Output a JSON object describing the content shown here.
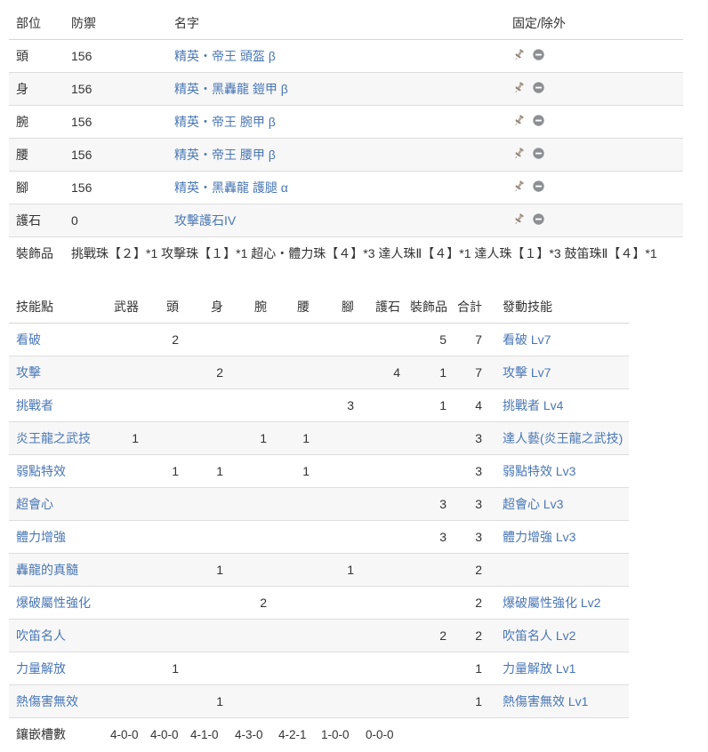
{
  "equipment_table": {
    "columns": [
      "部位",
      "防禦",
      "名字",
      "固定/除外"
    ],
    "rows": [
      {
        "part": "頭",
        "defense": "156",
        "name": "精英・帝王 頭盔 β",
        "pin_icon": "pushpin-icon",
        "exclude_icon": "minus-circle-icon"
      },
      {
        "part": "身",
        "defense": "156",
        "name": "精英・黑轟龍 鎧甲 β",
        "pin_icon": "pushpin-icon",
        "exclude_icon": "minus-circle-icon"
      },
      {
        "part": "腕",
        "defense": "156",
        "name": "精英・帝王 腕甲 β",
        "pin_icon": "pushpin-icon",
        "exclude_icon": "minus-circle-icon"
      },
      {
        "part": "腰",
        "defense": "156",
        "name": "精英・帝王 腰甲 β",
        "pin_icon": "pushpin-icon",
        "exclude_icon": "minus-circle-icon"
      },
      {
        "part": "腳",
        "defense": "156",
        "name": "精英・黑轟龍 護腿 α",
        "pin_icon": "pushpin-icon",
        "exclude_icon": "minus-circle-icon"
      },
      {
        "part": "護石",
        "defense": "0",
        "name": "攻擊護石IV",
        "pin_icon": "pushpin-icon",
        "exclude_icon": "minus-circle-icon"
      }
    ],
    "decoration_row": {
      "label": "裝飾品",
      "value": "挑戰珠【２】*1 攻擊珠【１】*1 超心・體力珠【４】*3 達人珠Ⅱ【４】*1 達人珠【１】*3 鼓笛珠Ⅱ【４】*1"
    }
  },
  "skill_table": {
    "columns": [
      "技能點",
      "武器",
      "頭",
      "身",
      "腕",
      "腰",
      "腳",
      "護石",
      "裝飾品",
      "合計",
      "發動技能"
    ],
    "rows": [
      {
        "skill": "看破",
        "weapon": "",
        "head": "2",
        "body": "",
        "arms": "",
        "waist": "",
        "legs": "",
        "charm": "",
        "deco": "5",
        "total": "7",
        "active": "看破 Lv7"
      },
      {
        "skill": "攻擊",
        "weapon": "",
        "head": "",
        "body": "2",
        "arms": "",
        "waist": "",
        "legs": "",
        "charm": "4",
        "deco": "1",
        "total": "7",
        "active": "攻擊 Lv7"
      },
      {
        "skill": "挑戰者",
        "weapon": "",
        "head": "",
        "body": "",
        "arms": "",
        "waist": "",
        "legs": "3",
        "charm": "",
        "deco": "1",
        "total": "4",
        "active": "挑戰者 Lv4"
      },
      {
        "skill": "炎王龍之武技",
        "weapon": "1",
        "head": "",
        "body": "",
        "arms": "1",
        "waist": "1",
        "legs": "",
        "charm": "",
        "deco": "",
        "total": "3",
        "active": "達人藝(炎王龍之武技)"
      },
      {
        "skill": "弱點特效",
        "weapon": "",
        "head": "1",
        "body": "1",
        "arms": "",
        "waist": "1",
        "legs": "",
        "charm": "",
        "deco": "",
        "total": "3",
        "active": "弱點特效 Lv3"
      },
      {
        "skill": "超會心",
        "weapon": "",
        "head": "",
        "body": "",
        "arms": "",
        "waist": "",
        "legs": "",
        "charm": "",
        "deco": "3",
        "total": "3",
        "active": "超會心 Lv3"
      },
      {
        "skill": "體力增強",
        "weapon": "",
        "head": "",
        "body": "",
        "arms": "",
        "waist": "",
        "legs": "",
        "charm": "",
        "deco": "3",
        "total": "3",
        "active": "體力增強 Lv3"
      },
      {
        "skill": "轟龍的真髓",
        "weapon": "",
        "head": "",
        "body": "1",
        "arms": "",
        "waist": "",
        "legs": "1",
        "charm": "",
        "deco": "",
        "total": "2",
        "active": ""
      },
      {
        "skill": "爆破屬性強化",
        "weapon": "",
        "head": "",
        "body": "",
        "arms": "2",
        "waist": "",
        "legs": "",
        "charm": "",
        "deco": "",
        "total": "2",
        "active": "爆破屬性強化 Lv2"
      },
      {
        "skill": "吹笛名人",
        "weapon": "",
        "head": "",
        "body": "",
        "arms": "",
        "waist": "",
        "legs": "",
        "charm": "",
        "deco": "2",
        "total": "2",
        "active": "吹笛名人 Lv2"
      },
      {
        "skill": "力量解放",
        "weapon": "",
        "head": "1",
        "body": "",
        "arms": "",
        "waist": "",
        "legs": "",
        "charm": "",
        "deco": "",
        "total": "1",
        "active": "力量解放 Lv1"
      },
      {
        "skill": "熱傷害無效",
        "weapon": "",
        "head": "",
        "body": "1",
        "arms": "",
        "waist": "",
        "legs": "",
        "charm": "",
        "deco": "",
        "total": "1",
        "active": "熱傷害無效 Lv1"
      }
    ],
    "slots_row": {
      "label": "鑲嵌槽數",
      "weapon": "4-0-0",
      "head": "4-0-0",
      "body": "4-1-0",
      "arms": "4-3-0",
      "waist": "4-2-1",
      "legs": "1-0-0",
      "charm": "0-0-0"
    }
  },
  "colors": {
    "link": "#4a77b5",
    "text": "#333333",
    "row_alt": "#f7f7f7",
    "border": "#dddddd",
    "icon_pin": "#8a7d73",
    "icon_exclude": "#8c8f93"
  }
}
